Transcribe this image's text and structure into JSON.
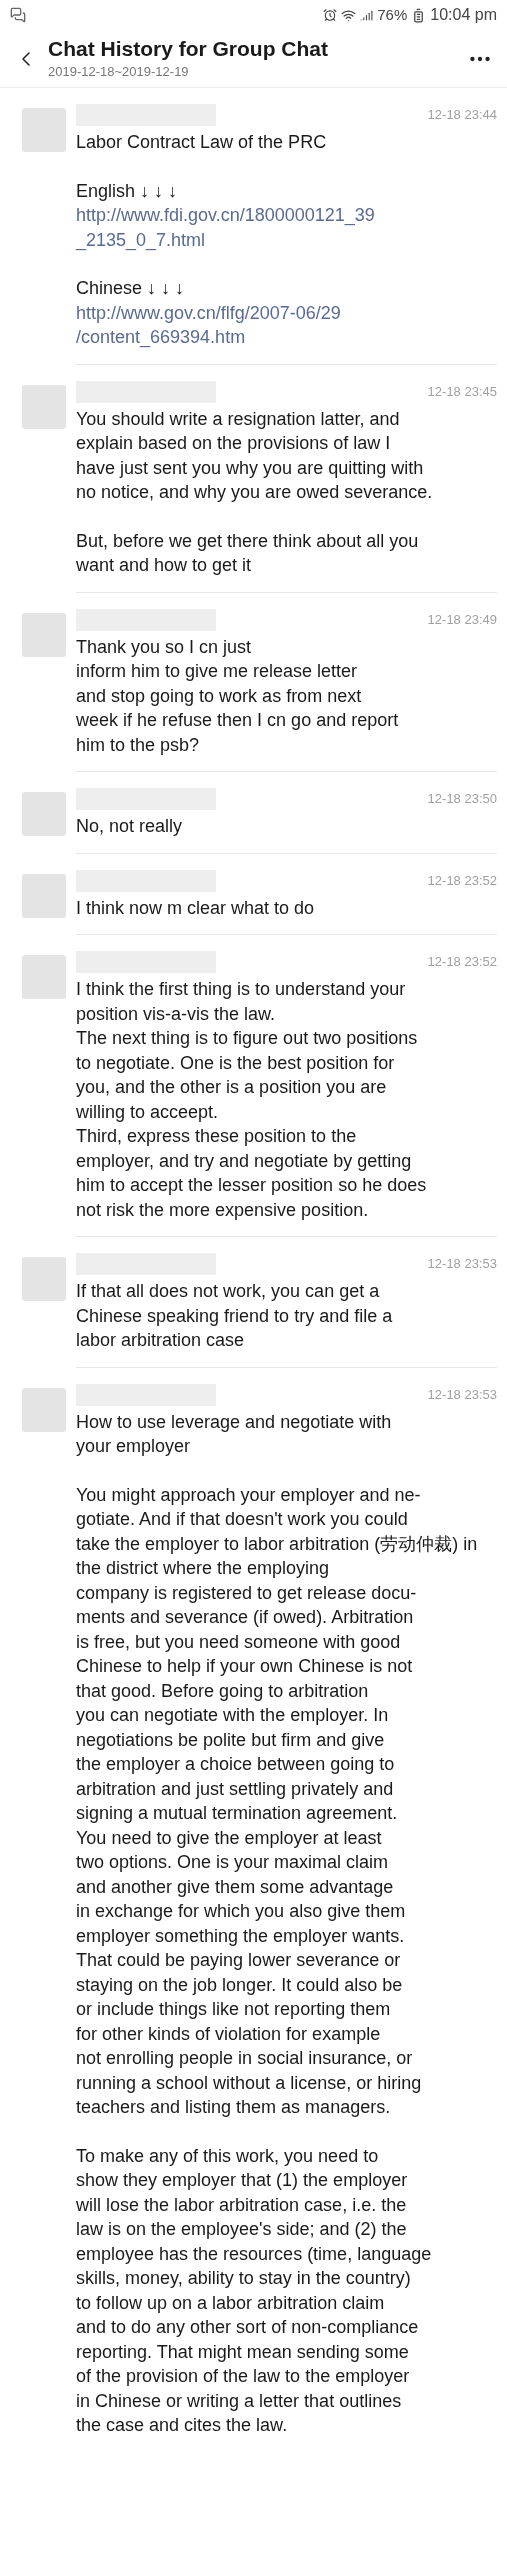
{
  "status_bar": {
    "battery": "76%",
    "time": "10:04 pm"
  },
  "header": {
    "title": "Chat History for Group Chat",
    "subtitle": "2019-12-18~2019-12-19"
  },
  "messages": [
    {
      "time": "12-18 23:44",
      "paragraphs": [
        [
          {
            "kind": "text",
            "text": "Labor Contract Law of the PRC"
          }
        ],
        [
          {
            "kind": "text",
            "text": "English ↓ ↓ ↓"
          },
          {
            "kind": "link",
            "text": "http://www.fdi.gov.cn/1800000121_39\n_2135_0_7.html"
          }
        ],
        [
          {
            "kind": "text",
            "text": "Chinese ↓ ↓ ↓"
          },
          {
            "kind": "link",
            "text": "http://www.gov.cn/flfg/2007-06/29\n/content_669394.htm"
          }
        ]
      ]
    },
    {
      "time": "12-18 23:45",
      "paragraphs": [
        [
          {
            "kind": "text",
            "text": "You should write a resignation latter, and\nexplain based on the provisions of law I\nhave just sent you why you are quitting with\nno notice, and why you are owed severance."
          }
        ],
        [
          {
            "kind": "text",
            "text": "But, before we get there think about all you\nwant and how to get it"
          }
        ]
      ]
    },
    {
      "time": "12-18 23:49",
      "paragraphs": [
        [
          {
            "kind": "text",
            "text": "Thank you so I cn just\ninform him to give me release letter\nand stop going to work as from next\nweek if he refuse then I cn go and report\nhim to the psb?"
          }
        ]
      ]
    },
    {
      "time": "12-18 23:50",
      "paragraphs": [
        [
          {
            "kind": "text",
            "text": "No, not really"
          }
        ]
      ]
    },
    {
      "time": "12-18 23:52",
      "paragraphs": [
        [
          {
            "kind": "text",
            "text": "I think now m clear what to do"
          }
        ]
      ]
    },
    {
      "time": "12-18 23:52",
      "paragraphs": [
        [
          {
            "kind": "text",
            "text": "I think the first thing is to understand your\nposition vis-a-vis the law.\nThe next thing is to figure out two positions\nto negotiate. One is the best position for\nyou, and the other is a position you are\nwilling to acceept.\nThird, express these position to the\nemployer, and try and negotiate by getting\nhim to accept the lesser position so he does\nnot risk the more expensive position."
          }
        ]
      ]
    },
    {
      "time": "12-18 23:53",
      "paragraphs": [
        [
          {
            "kind": "text",
            "text": "If that all does not work, you can get a\nChinese speaking friend to try and file a\nlabor arbitration case"
          }
        ]
      ]
    },
    {
      "time": "12-18 23:53",
      "paragraphs": [
        [
          {
            "kind": "text",
            "text": "How to use leverage and negotiate with\nyour employer"
          }
        ],
        [
          {
            "kind": "text",
            "text": "You might approach your employer and ne-\ngotiate. And if that doesn't work you could\ntake the employer to labor arbitration (劳动仲裁) in the district where the employing\ncompany is registered to get release docu-\nments and severance (if owed). Arbitration\nis free, but you need someone with good\nChinese to help if your own Chinese is not\nthat good. Before going to arbitration\nyou can negotiate with the employer. In\nnegotiations be polite but firm and give\nthe employer a choice between going to\narbitration and just settling privately and\nsigning a mutual termination agreement.\nYou need to give the employer at least\ntwo options. One is your maximal claim\nand another give them some advantage\nin exchange for which you also give them\nemployer something the employer wants.\nThat could be paying lower severance or\nstaying on the job longer. It could also be\nor include things like not reporting them\nfor other kinds of violation for example\nnot enrolling people in social insurance, or\nrunning a school without a license, or hiring\nteachers and listing them as managers."
          }
        ],
        [
          {
            "kind": "text",
            "text": "To make any of this work, you need to\nshow they employer that (1) the employer\nwill lose the labor arbitration case, i.e. the\nlaw is on the employee's side; and (2) the\nemployee has the resources (time, language\nskills, money, ability to stay in the country)\nto follow up on a labor arbitration claim\nand to do any other sort of non-compliance\nreporting. That might mean sending some\nof the provision of the law to the employer\nin Chinese or writing a letter that outlines\nthe case and cites the law."
          }
        ]
      ]
    }
  ]
}
